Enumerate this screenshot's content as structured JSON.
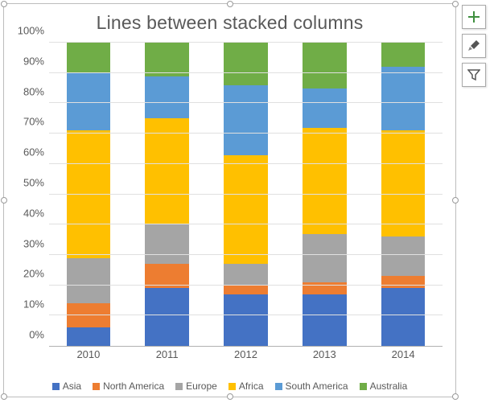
{
  "chart_data": {
    "type": "stacked-bar-100",
    "title": "Lines between stacked columns",
    "xlabel": "",
    "ylabel": "",
    "ylim": [
      0,
      100
    ],
    "y_ticks": [
      "0%",
      "10%",
      "20%",
      "30%",
      "40%",
      "50%",
      "60%",
      "70%",
      "80%",
      "90%",
      "100%"
    ],
    "categories": [
      "2010",
      "2011",
      "2012",
      "2013",
      "2014"
    ],
    "series": [
      {
        "name": "Asia",
        "color": "#4472C4",
        "values": [
          6,
          19,
          17,
          17,
          19
        ]
      },
      {
        "name": "North America",
        "color": "#ED7D31",
        "values": [
          8,
          8,
          3,
          4,
          4
        ]
      },
      {
        "name": "Europe",
        "color": "#A5A5A5",
        "values": [
          15,
          13,
          7,
          16,
          13
        ]
      },
      {
        "name": "Africa",
        "color": "#FFC000",
        "values": [
          42,
          35,
          36,
          35,
          35
        ]
      },
      {
        "name": "South America",
        "color": "#5B9BD5",
        "values": [
          19,
          14,
          23,
          13,
          21
        ]
      },
      {
        "name": "Australia",
        "color": "#70AD47",
        "values": [
          10,
          11,
          14,
          15,
          8
        ]
      }
    ],
    "legend_position": "bottom",
    "grid": true
  },
  "side_buttons": [
    {
      "name": "chart-elements",
      "icon": "plus-icon"
    },
    {
      "name": "chart-styles",
      "icon": "brush-icon"
    },
    {
      "name": "chart-filters",
      "icon": "funnel-icon"
    }
  ]
}
